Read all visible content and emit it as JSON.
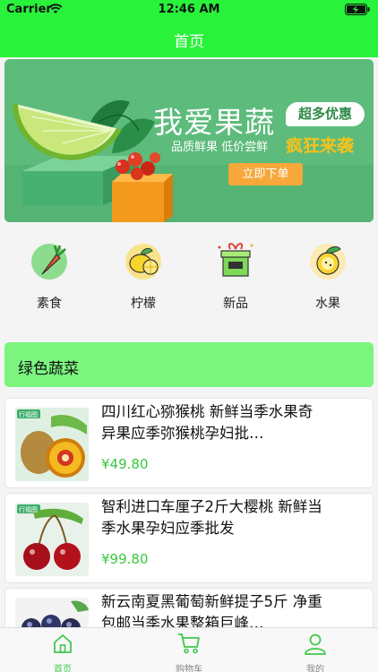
{
  "status_bar": {
    "carrier": "Carrier",
    "time": "12:46 AM"
  },
  "nav": {
    "title": "首页"
  },
  "banner": {
    "headline": "我爱果蔬",
    "badge": "超多优惠",
    "subtitle": "品质鲜果  低价尝鲜",
    "slogan": "疯狂来袭",
    "order_button": "立即下单"
  },
  "categories": [
    {
      "label": "素食",
      "icon": "carrot-icon"
    },
    {
      "label": "柠檬",
      "icon": "lemon-icon"
    },
    {
      "label": "新品",
      "icon": "gift-box-icon"
    },
    {
      "label": "水果",
      "icon": "fruit-icon"
    }
  ],
  "section": {
    "title": "绿色蔬菜"
  },
  "products": [
    {
      "name": "四川红心猕猴桃 新鲜当季水果奇异果应季弥猴桃孕妇批…",
      "price": "¥49.80",
      "tag": "行福图",
      "icon": "kiwi-image"
    },
    {
      "name": "智利进口车厘子2斤大樱桃 新鲜当季水果孕妇应季批发",
      "price": "¥99.80",
      "tag": "行福图",
      "icon": "cherry-image"
    },
    {
      "name": "新云南夏黑葡萄新鲜提子5斤 净重包邮当季水果整箱巨峰…",
      "price": "",
      "tag": "",
      "icon": "grape-image"
    }
  ],
  "tabs": [
    {
      "label": "首页",
      "icon": "home-icon",
      "active": true
    },
    {
      "label": "购物车",
      "icon": "cart-icon",
      "active": false
    },
    {
      "label": "我的",
      "icon": "user-icon",
      "active": false
    }
  ],
  "colors": {
    "accent": "#29f23b",
    "section_bg": "#7cf57f",
    "price": "#37c93d",
    "banner_bg": "#5dbb7c",
    "tab_active": "#3fc84a"
  }
}
